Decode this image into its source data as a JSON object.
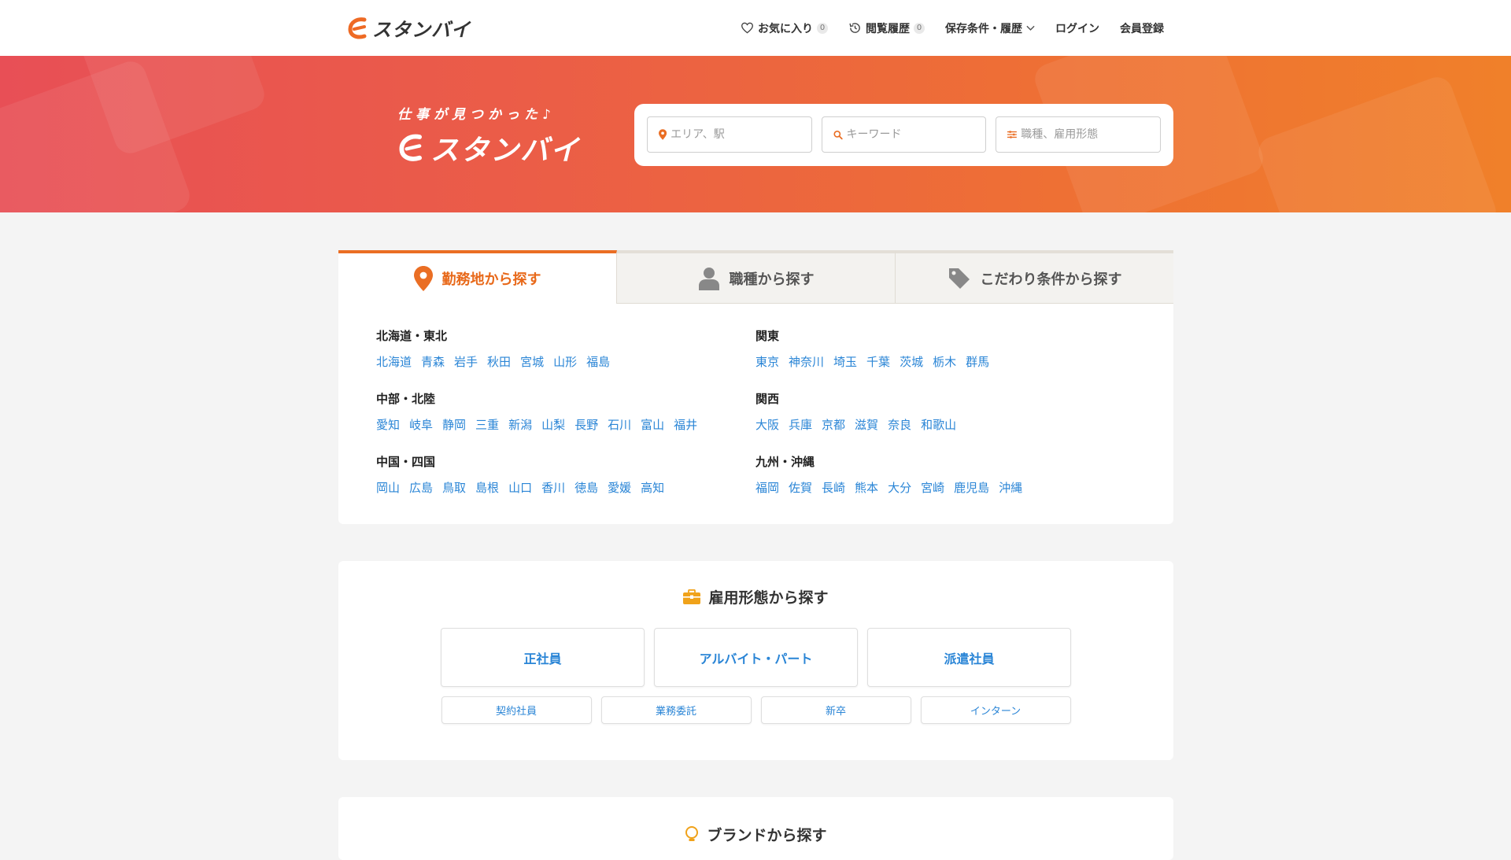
{
  "header": {
    "logo_text": "スタンバイ",
    "nav": {
      "favorites_label": "お気に入り",
      "favorites_count": "0",
      "history_label": "閲覧履歴",
      "history_count": "0",
      "saved_label": "保存条件・履歴",
      "login_label": "ログイン",
      "register_label": "会員登録"
    }
  },
  "hero": {
    "tagline": "仕事が見つかった♪",
    "logo_text": "スタンバイ",
    "search": {
      "area_placeholder": "エリア、駅",
      "keyword_placeholder": "キーワード",
      "job_placeholder": "職種、雇用形態"
    }
  },
  "tabs": [
    {
      "label": "勤務地から探す",
      "icon": "location-pin-icon",
      "active": true
    },
    {
      "label": "職種から探す",
      "icon": "person-icon",
      "active": false
    },
    {
      "label": "こだわり条件から探す",
      "icon": "tag-icon",
      "active": false
    }
  ],
  "regions": [
    {
      "title": "北海道・東北",
      "prefs": [
        "北海道",
        "青森",
        "岩手",
        "秋田",
        "宮城",
        "山形",
        "福島"
      ]
    },
    {
      "title": "関東",
      "prefs": [
        "東京",
        "神奈川",
        "埼玉",
        "千葉",
        "茨城",
        "栃木",
        "群馬"
      ]
    },
    {
      "title": "中部・北陸",
      "prefs": [
        "愛知",
        "岐阜",
        "静岡",
        "三重",
        "新潟",
        "山梨",
        "長野",
        "石川",
        "富山",
        "福井"
      ]
    },
    {
      "title": "関西",
      "prefs": [
        "大阪",
        "兵庫",
        "京都",
        "滋賀",
        "奈良",
        "和歌山"
      ]
    },
    {
      "title": "中国・四国",
      "prefs": [
        "岡山",
        "広島",
        "鳥取",
        "島根",
        "山口",
        "香川",
        "徳島",
        "愛媛",
        "高知"
      ]
    },
    {
      "title": "九州・沖縄",
      "prefs": [
        "福岡",
        "佐賀",
        "長崎",
        "熊本",
        "大分",
        "宮崎",
        "鹿児島",
        "沖縄"
      ]
    }
  ],
  "employment": {
    "title": "雇用形態から探す",
    "icon": "briefcase-icon",
    "primary": [
      "正社員",
      "アルバイト・パート",
      "派遣社員"
    ],
    "secondary": [
      "契約社員",
      "業務委託",
      "新卒",
      "インターン"
    ]
  },
  "brand_section": {
    "title": "ブランドから探す",
    "icon": "lightbulb-icon"
  },
  "colors": {
    "accent": "#ea6e24",
    "link": "#2a85d6",
    "hero_start": "#e84f56",
    "hero_end": "#f0802a"
  }
}
